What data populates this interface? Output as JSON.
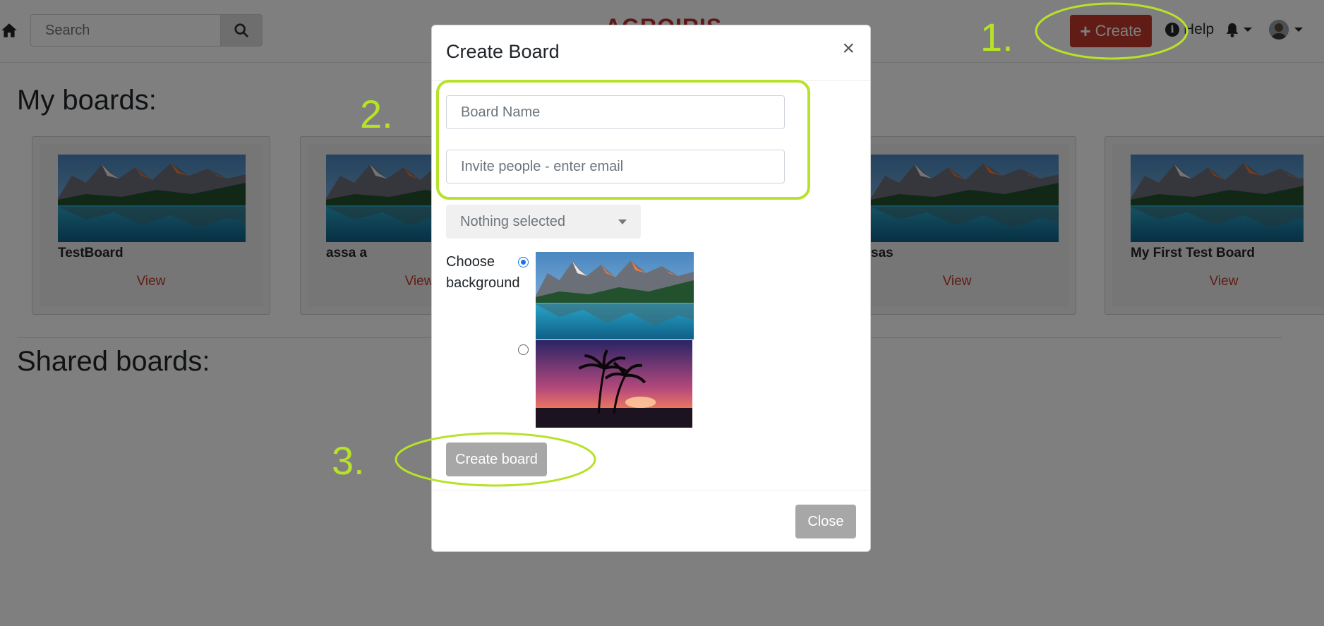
{
  "navbar": {
    "search_placeholder": "Search",
    "brand": "AGROIRIS",
    "create_label": "Create",
    "help_label": "Help"
  },
  "my_boards": {
    "title": "My boards:",
    "cards": [
      {
        "title": "TestBoard",
        "view": "View"
      },
      {
        "title": "assa a",
        "view": "View"
      },
      {
        "title": "sas",
        "view": "View"
      },
      {
        "title": "My First Test Board",
        "view": "View"
      }
    ]
  },
  "shared_boards": {
    "title": "Shared boards:"
  },
  "modal": {
    "title": "Create Board",
    "close_x": "×",
    "board_name_placeholder": "Board Name",
    "invite_placeholder": "Invite people - enter email",
    "select_value": "Nothing selected",
    "background_label": "Choose background",
    "backgrounds": [
      {
        "name": "mountain-lake",
        "selected": true
      },
      {
        "name": "palm-sunset",
        "selected": false
      }
    ],
    "create_board_label": "Create board",
    "close_label": "Close"
  },
  "annotations": {
    "step1": "1.",
    "step2": "2.",
    "step3": "3."
  },
  "colors": {
    "accent_red": "#c0392b",
    "annotation_green": "#b8e22a",
    "backdrop": "rgba(0,0,0,0.5)"
  }
}
